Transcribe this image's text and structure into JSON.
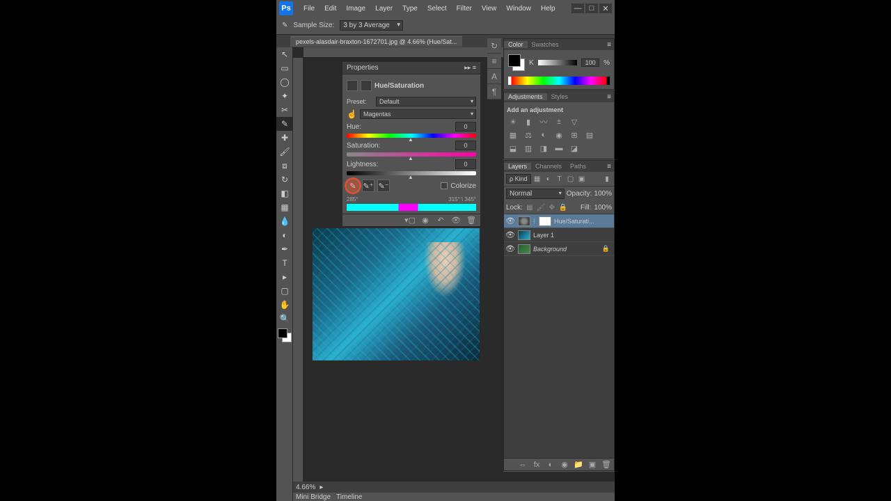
{
  "menubar": [
    "File",
    "Edit",
    "Image",
    "Layer",
    "Type",
    "Select",
    "Filter",
    "View",
    "Window",
    "Help"
  ],
  "optionsbar": {
    "sample_label": "Sample Size:",
    "sample_value": "3 by 3 Average"
  },
  "document_tab": "pexels-alasdair-braxton-1672701.jpg @ 4.66% (Hue/Sat...",
  "properties": {
    "title": "Properties",
    "adjustment_name": "Hue/Saturation",
    "preset_label": "Preset:",
    "preset_value": "Default",
    "channel_value": "Magentas",
    "hue": {
      "label": "Hue:",
      "value": "0"
    },
    "saturation": {
      "label": "Saturation:",
      "value": "0"
    },
    "lightness": {
      "label": "Lightness:",
      "value": "0"
    },
    "colorize_label": "Colorize",
    "range_left": "285°",
    "range_right": "315° \\ 345°"
  },
  "color_panel": {
    "tabs": [
      "Color",
      "Swatches"
    ],
    "k_label": "K",
    "k_value": "100",
    "k_unit": "%"
  },
  "adjustments_panel": {
    "tabs": [
      "Adjustments",
      "Styles"
    ],
    "title": "Add an adjustment"
  },
  "layers_panel": {
    "tabs": [
      "Layers",
      "Channels",
      "Paths"
    ],
    "kind_label": "ρ Kind",
    "blend_mode": "Normal",
    "opacity_label": "Opacity:",
    "opacity_value": "100%",
    "lock_label": "Lock:",
    "fill_label": "Fill:",
    "fill_value": "100%",
    "layers": [
      {
        "name": "Hue/Saturati...",
        "selected": true,
        "type": "adj"
      },
      {
        "name": "Layer 1",
        "selected": false,
        "type": "img"
      },
      {
        "name": "Background",
        "selected": false,
        "type": "green",
        "locked": true
      }
    ]
  },
  "status": {
    "zoom": "4.66%"
  },
  "minibar": [
    "Mini Bridge",
    "Timeline"
  ]
}
